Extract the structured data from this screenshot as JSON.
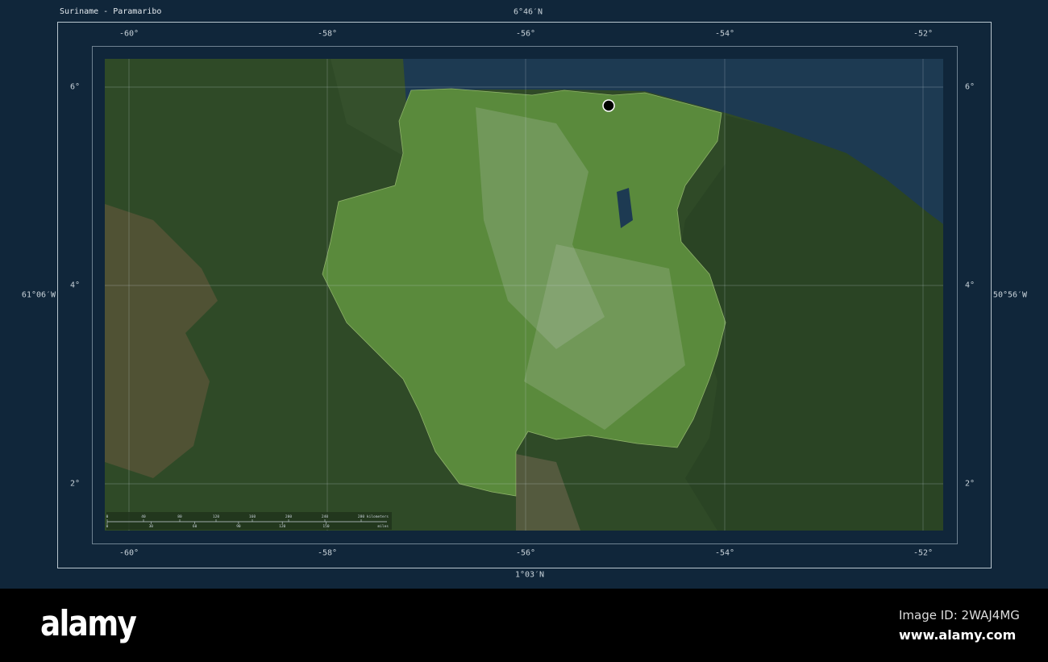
{
  "title": "Suriname - Paramaribo",
  "extent": {
    "north": "6°46′N",
    "south": "1°03′N",
    "west": "61°06′W",
    "east": "50°56′W"
  },
  "longitudes": [
    "-60°",
    "-58°",
    "-56°",
    "-54°",
    "-52°"
  ],
  "latitudes": [
    "6°",
    "4°",
    "2°"
  ],
  "scale_bar": {
    "km_ticks": [
      "0",
      "40",
      "80",
      "120",
      "160",
      "200",
      "240",
      "280"
    ],
    "km_label": "kilometers",
    "mi_ticks": [
      "0",
      "30",
      "60",
      "90",
      "120",
      "150"
    ],
    "mi_label": "miles"
  },
  "capital": {
    "name": "Paramaribo"
  },
  "colors": {
    "background": "#10263a",
    "ocean": "#1d3a52",
    "forest": "#2f4a27",
    "highlight": "#4f7a35"
  },
  "footer": {
    "logo": "alamy",
    "image_id": "Image ID: 2WAJ4MG",
    "site": "www.alamy.com"
  }
}
